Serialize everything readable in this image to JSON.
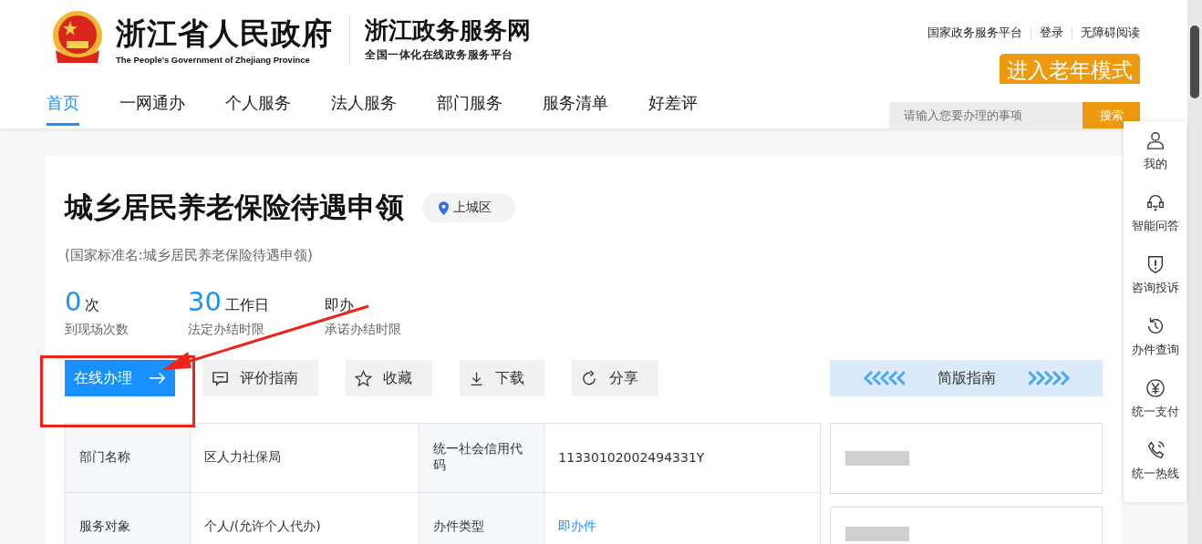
{
  "header": {
    "title": "浙江省人民政府",
    "subtitle": "The People's Government of Zhejiang Province",
    "portal_title": "浙江政务服务网",
    "portal_subtitle": "全国一体化在线政务服务平台",
    "top_links": [
      "国家政务服务平台",
      "登录",
      "无障碍阅读"
    ],
    "elder_mode_button": "进入老年模式",
    "search": {
      "placeholder": "请输入您要办理的事项",
      "button": "搜索"
    }
  },
  "nav": [
    {
      "label": "首页",
      "selected": true
    },
    {
      "label": "一网通办",
      "selected": false
    },
    {
      "label": "个人服务",
      "selected": false
    },
    {
      "label": "法人服务",
      "selected": false
    },
    {
      "label": "部门服务",
      "selected": false
    },
    {
      "label": "服务清单",
      "selected": false
    },
    {
      "label": "好差评",
      "selected": false
    }
  ],
  "item": {
    "title": "城乡居民养老保险待遇申领",
    "region": "上城区",
    "standard_name": "(国家标准名:城乡居民养老保险待遇申领)",
    "stats": [
      {
        "value": "0",
        "unit": "次",
        "label": "到现场次数"
      },
      {
        "value": "30",
        "unit": "工作日",
        "label": "法定办结时限"
      },
      {
        "unit": "即办",
        "label": "承诺办结时限"
      }
    ],
    "actions": [
      {
        "label": "在线办理",
        "kind": "primary"
      },
      {
        "label": "评价指南",
        "kind": "rate"
      },
      {
        "label": "收藏",
        "kind": "star"
      },
      {
        "label": "下载",
        "kind": "download"
      },
      {
        "label": "分享",
        "kind": "share"
      }
    ],
    "simple_guide": "简版指南",
    "table": {
      "rows": [
        [
          {
            "text": "部门名称",
            "kind": "label"
          },
          {
            "text": "区人力社保局",
            "kind": "value"
          },
          {
            "text": "统一社会信用代码",
            "kind": "label"
          },
          {
            "text": "11330102002494331Y",
            "kind": "value"
          }
        ],
        [
          {
            "text": "服务对象",
            "kind": "label"
          },
          {
            "text": "个人/(允许个人代办)",
            "kind": "value"
          },
          {
            "text": "办件类型",
            "kind": "label"
          },
          {
            "text": "即办件",
            "kind": "link"
          }
        ]
      ]
    }
  },
  "side_menu": [
    {
      "label": "我的",
      "kind": "user"
    },
    {
      "label": "智能问答",
      "kind": "headset"
    },
    {
      "label": "咨询投诉",
      "kind": "shield"
    },
    {
      "label": "办件查询",
      "kind": "history"
    },
    {
      "label": "统一支付",
      "kind": "yen"
    },
    {
      "label": "统一热线",
      "kind": "phone"
    }
  ]
}
